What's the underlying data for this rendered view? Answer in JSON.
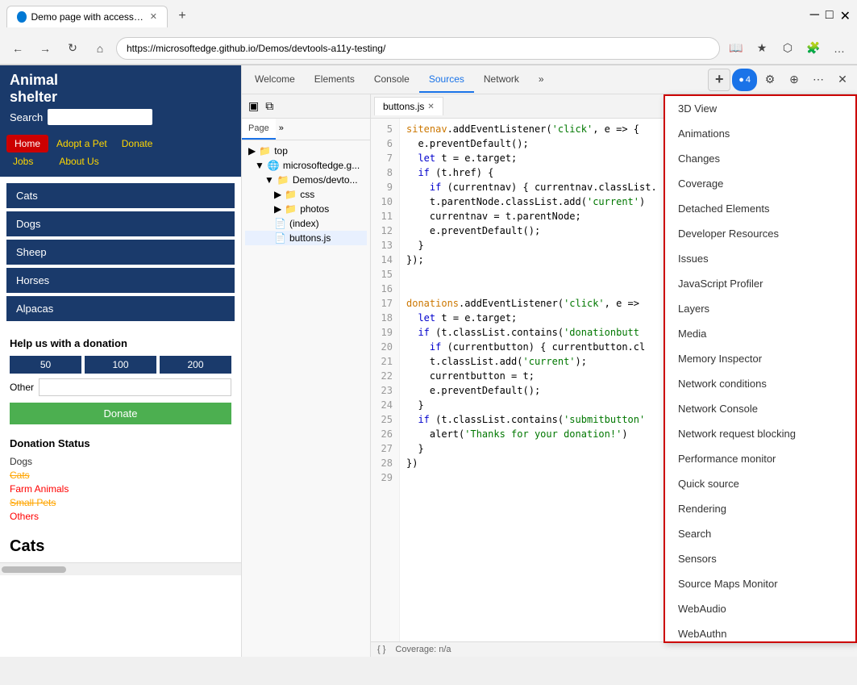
{
  "browser": {
    "tab_title": "Demo page with accessibility iss",
    "url": "https://microsoftedge.github.io/Demos/devtools-a11y-testing/",
    "new_tab_label": "+",
    "nav_back": "←",
    "nav_forward": "→",
    "nav_refresh": "↻",
    "nav_home": "⌂"
  },
  "website": {
    "logo_line1": "Animal",
    "logo_line2": "shelter",
    "search_label": "Search",
    "nav": {
      "home": "Home",
      "adopt": "Adopt a Pet",
      "donate": "Donate",
      "jobs": "Jobs",
      "about": "About Us"
    },
    "animals": [
      "Cats",
      "Dogs",
      "Sheep",
      "Horses",
      "Alpacas"
    ],
    "donation": {
      "title": "Help us with a donation",
      "amounts": [
        "50",
        "100",
        "200"
      ],
      "other_label": "Other",
      "donate_btn": "Donate"
    },
    "status": {
      "title": "Donation Status",
      "items": [
        {
          "label": "Dogs",
          "class": "status-dogs"
        },
        {
          "label": "Cats",
          "class": "status-cats"
        },
        {
          "label": "Farm Animals",
          "class": "status-farm"
        },
        {
          "label": "Small Pets",
          "class": "status-small"
        },
        {
          "label": "Others",
          "class": "status-others"
        }
      ]
    },
    "section_title": "Cats"
  },
  "devtools": {
    "tabs": [
      "Welcome",
      "Elements",
      "Console",
      "Sources",
      "Network"
    ],
    "active_tab": "Sources",
    "more_label": "»",
    "actions": {
      "add": "+",
      "settings": "⚙",
      "customize": "⋯",
      "close": "✕",
      "badge_count": "4"
    },
    "sources": {
      "tabs": [
        "Page",
        "»"
      ],
      "file_tree": [
        {
          "label": "▶ top",
          "indent": 0
        },
        {
          "label": "↳ microsoftedge.g...",
          "indent": 1
        },
        {
          "label": "↳ Demos/devto...",
          "indent": 2
        },
        {
          "label": "▶ css",
          "indent": 3
        },
        {
          "label": "▶ photos",
          "indent": 3
        },
        {
          "label": "(index)",
          "indent": 3
        },
        {
          "label": "buttons.js",
          "indent": 3,
          "selected": true
        }
      ]
    },
    "editor": {
      "file": "buttons.js",
      "lines": [
        {
          "num": 5,
          "code": "sitenav.addEventListener('click', e => {"
        },
        {
          "num": 6,
          "code": "  e.preventDefault();"
        },
        {
          "num": 7,
          "code": "  let t = e.target;"
        },
        {
          "num": 8,
          "code": "  if (t.href) {"
        },
        {
          "num": 9,
          "code": "    if (currentnav) { currentnav.classList."
        },
        {
          "num": 10,
          "code": "    t.parentNode.classList.add('current')"
        },
        {
          "num": 11,
          "code": "    currentnav = t.parentNode;"
        },
        {
          "num": 12,
          "code": "    e.preventDefault();"
        },
        {
          "num": 13,
          "code": "  }"
        },
        {
          "num": 14,
          "code": "});"
        },
        {
          "num": 15,
          "code": ""
        },
        {
          "num": 16,
          "code": ""
        },
        {
          "num": 17,
          "code": ""
        },
        {
          "num": 18,
          "code": "donations.addEventListener('click', e =>"
        },
        {
          "num": 19,
          "code": "  let t = e.target;"
        },
        {
          "num": 20,
          "code": "  if (t.classList.contains('donationbutt"
        },
        {
          "num": 21,
          "code": "    if (currentbutton) { currentbutton.cl"
        },
        {
          "num": 22,
          "code": "    t.classList.add('current');"
        },
        {
          "num": 23,
          "code": "    currentbutton = t;"
        },
        {
          "num": 24,
          "code": "    e.preventDefault();"
        },
        {
          "num": 25,
          "code": "  }"
        },
        {
          "num": 26,
          "code": "  if (t.classList.contains('submitbutton'"
        },
        {
          "num": 27,
          "code": "    alert('Thanks for your donation!')"
        },
        {
          "num": 28,
          "code": "  }"
        },
        {
          "num": 29,
          "code": "})"
        }
      ]
    },
    "status_bar": {
      "braces": "{ }",
      "coverage": "Coverage: n/a"
    }
  },
  "dropdown": {
    "items": [
      "3D View",
      "Animations",
      "Changes",
      "Coverage",
      "Detached Elements",
      "Developer Resources",
      "Issues",
      "JavaScript Profiler",
      "Layers",
      "Media",
      "Memory Inspector",
      "Network conditions",
      "Network Console",
      "Network request blocking",
      "Performance monitor",
      "Quick source",
      "Rendering",
      "Search",
      "Sensors",
      "Source Maps Monitor",
      "WebAudio",
      "WebAuthn"
    ]
  }
}
